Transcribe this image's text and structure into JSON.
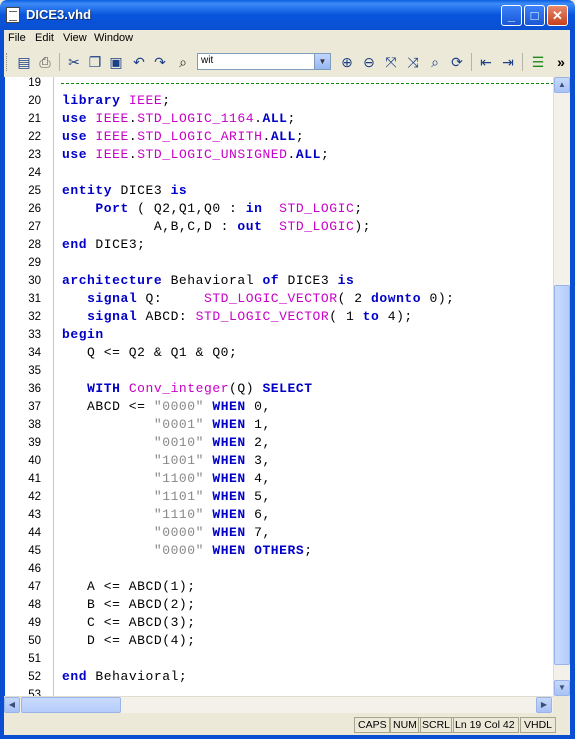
{
  "window": {
    "title": "DICE3.vhd",
    "minimize": "_",
    "maximize": "□",
    "close": "✕"
  },
  "menu": [
    "File",
    "Edit",
    "View",
    "Window"
  ],
  "toolbar": {
    "search_value": "wit",
    "icons": [
      "save-icon",
      "print-icon",
      "cut-icon",
      "copy-icon",
      "paste-icon",
      "undo-icon",
      "redo-icon",
      "find-icon",
      "zoom-in-icon",
      "zoom-out-icon",
      "fit-icon",
      "zoom-reset-icon",
      "zoom-custom-icon",
      "refresh-icon",
      "outdent-icon",
      "indent-icon",
      "comment-icon",
      "more-icon"
    ]
  },
  "editor": {
    "lines": [
      {
        "n": "19",
        "t": []
      },
      {
        "n": "20",
        "t": [
          {
            "c": "kw",
            "s": "library"
          },
          {
            "c": "",
            "s": " "
          },
          {
            "c": "ty",
            "s": "IEEE"
          },
          {
            "c": "",
            "s": ";"
          }
        ]
      },
      {
        "n": "21",
        "t": [
          {
            "c": "kw",
            "s": "use"
          },
          {
            "c": "",
            "s": " "
          },
          {
            "c": "ty",
            "s": "IEEE"
          },
          {
            "c": "",
            "s": "."
          },
          {
            "c": "ty",
            "s": "STD_LOGIC_1164"
          },
          {
            "c": "",
            "s": "."
          },
          {
            "c": "kw",
            "s": "ALL"
          },
          {
            "c": "",
            "s": ";"
          }
        ]
      },
      {
        "n": "22",
        "t": [
          {
            "c": "kw",
            "s": "use"
          },
          {
            "c": "",
            "s": " "
          },
          {
            "c": "ty",
            "s": "IEEE"
          },
          {
            "c": "",
            "s": "."
          },
          {
            "c": "ty",
            "s": "STD_LOGIC_ARITH"
          },
          {
            "c": "",
            "s": "."
          },
          {
            "c": "kw",
            "s": "ALL"
          },
          {
            "c": "",
            "s": ";"
          }
        ]
      },
      {
        "n": "23",
        "t": [
          {
            "c": "kw",
            "s": "use"
          },
          {
            "c": "",
            "s": " "
          },
          {
            "c": "ty",
            "s": "IEEE"
          },
          {
            "c": "",
            "s": "."
          },
          {
            "c": "ty",
            "s": "STD_LOGIC_UNSIGNED"
          },
          {
            "c": "",
            "s": "."
          },
          {
            "c": "kw",
            "s": "ALL"
          },
          {
            "c": "",
            "s": ";"
          }
        ]
      },
      {
        "n": "24",
        "t": []
      },
      {
        "n": "25",
        "t": [
          {
            "c": "kw",
            "s": "entity"
          },
          {
            "c": "",
            "s": " DICE3 "
          },
          {
            "c": "kw",
            "s": "is"
          }
        ]
      },
      {
        "n": "26",
        "t": [
          {
            "c": "",
            "s": "    "
          },
          {
            "c": "kw",
            "s": "Port"
          },
          {
            "c": "",
            "s": " ( Q2,Q1,Q0 : "
          },
          {
            "c": "kw",
            "s": "in"
          },
          {
            "c": "",
            "s": "  "
          },
          {
            "c": "ty",
            "s": "STD_LOGIC"
          },
          {
            "c": "",
            "s": ";"
          }
        ]
      },
      {
        "n": "27",
        "t": [
          {
            "c": "",
            "s": "           A,B,C,D : "
          },
          {
            "c": "kw",
            "s": "out"
          },
          {
            "c": "",
            "s": "  "
          },
          {
            "c": "ty",
            "s": "STD_LOGIC"
          },
          {
            "c": "",
            "s": ");"
          }
        ]
      },
      {
        "n": "28",
        "t": [
          {
            "c": "kw",
            "s": "end"
          },
          {
            "c": "",
            "s": " DICE3;"
          }
        ]
      },
      {
        "n": "29",
        "t": []
      },
      {
        "n": "30",
        "t": [
          {
            "c": "kw",
            "s": "architecture"
          },
          {
            "c": "",
            "s": " Behavioral "
          },
          {
            "c": "kw",
            "s": "of"
          },
          {
            "c": "",
            "s": " DICE3 "
          },
          {
            "c": "kw",
            "s": "is"
          }
        ]
      },
      {
        "n": "31",
        "t": [
          {
            "c": "",
            "s": "   "
          },
          {
            "c": "kw",
            "s": "signal"
          },
          {
            "c": "",
            "s": " Q:     "
          },
          {
            "c": "ty",
            "s": "STD_LOGIC_VECTOR"
          },
          {
            "c": "",
            "s": "( 2 "
          },
          {
            "c": "kw",
            "s": "downto"
          },
          {
            "c": "",
            "s": " 0);"
          }
        ]
      },
      {
        "n": "32",
        "t": [
          {
            "c": "",
            "s": "   "
          },
          {
            "c": "kw",
            "s": "signal"
          },
          {
            "c": "",
            "s": " ABCD: "
          },
          {
            "c": "ty",
            "s": "STD_LOGIC_VECTOR"
          },
          {
            "c": "",
            "s": "( 1 "
          },
          {
            "c": "kw",
            "s": "to"
          },
          {
            "c": "",
            "s": " 4);"
          }
        ]
      },
      {
        "n": "33",
        "t": [
          {
            "c": "kw",
            "s": "begin"
          }
        ]
      },
      {
        "n": "34",
        "t": [
          {
            "c": "",
            "s": "   Q <= Q2 & Q1 & Q0;"
          }
        ]
      },
      {
        "n": "35",
        "t": []
      },
      {
        "n": "36",
        "t": [
          {
            "c": "",
            "s": "   "
          },
          {
            "c": "kw",
            "s": "WITH"
          },
          {
            "c": "",
            "s": " "
          },
          {
            "c": "ty",
            "s": "Conv_integer"
          },
          {
            "c": "",
            "s": "(Q) "
          },
          {
            "c": "kw",
            "s": "SELECT"
          }
        ]
      },
      {
        "n": "37",
        "t": [
          {
            "c": "",
            "s": "   ABCD <= "
          },
          {
            "c": "st",
            "s": "\"0000\""
          },
          {
            "c": "",
            "s": " "
          },
          {
            "c": "kw",
            "s": "WHEN"
          },
          {
            "c": "",
            "s": " 0,"
          }
        ]
      },
      {
        "n": "38",
        "t": [
          {
            "c": "",
            "s": "           "
          },
          {
            "c": "st",
            "s": "\"0001\""
          },
          {
            "c": "",
            "s": " "
          },
          {
            "c": "kw",
            "s": "WHEN"
          },
          {
            "c": "",
            "s": " 1,"
          }
        ]
      },
      {
        "n": "39",
        "t": [
          {
            "c": "",
            "s": "           "
          },
          {
            "c": "st",
            "s": "\"0010\""
          },
          {
            "c": "",
            "s": " "
          },
          {
            "c": "kw",
            "s": "WHEN"
          },
          {
            "c": "",
            "s": " 2,"
          }
        ]
      },
      {
        "n": "40",
        "t": [
          {
            "c": "",
            "s": "           "
          },
          {
            "c": "st",
            "s": "\"1001\""
          },
          {
            "c": "",
            "s": " "
          },
          {
            "c": "kw",
            "s": "WHEN"
          },
          {
            "c": "",
            "s": " 3,"
          }
        ]
      },
      {
        "n": "41",
        "t": [
          {
            "c": "",
            "s": "           "
          },
          {
            "c": "st",
            "s": "\"1100\""
          },
          {
            "c": "",
            "s": " "
          },
          {
            "c": "kw",
            "s": "WHEN"
          },
          {
            "c": "",
            "s": " 4,"
          }
        ]
      },
      {
        "n": "42",
        "t": [
          {
            "c": "",
            "s": "           "
          },
          {
            "c": "st",
            "s": "\"1101\""
          },
          {
            "c": "",
            "s": " "
          },
          {
            "c": "kw",
            "s": "WHEN"
          },
          {
            "c": "",
            "s": " 5,"
          }
        ]
      },
      {
        "n": "43",
        "t": [
          {
            "c": "",
            "s": "           "
          },
          {
            "c": "st",
            "s": "\"1110\""
          },
          {
            "c": "",
            "s": " "
          },
          {
            "c": "kw",
            "s": "WHEN"
          },
          {
            "c": "",
            "s": " 6,"
          }
        ]
      },
      {
        "n": "44",
        "t": [
          {
            "c": "",
            "s": "           "
          },
          {
            "c": "st",
            "s": "\"0000\""
          },
          {
            "c": "",
            "s": " "
          },
          {
            "c": "kw",
            "s": "WHEN"
          },
          {
            "c": "",
            "s": " 7,"
          }
        ]
      },
      {
        "n": "45",
        "t": [
          {
            "c": "",
            "s": "           "
          },
          {
            "c": "st",
            "s": "\"0000\""
          },
          {
            "c": "",
            "s": " "
          },
          {
            "c": "kw",
            "s": "WHEN"
          },
          {
            "c": "",
            "s": " "
          },
          {
            "c": "kw",
            "s": "OTHERS"
          },
          {
            "c": "",
            "s": ";"
          }
        ]
      },
      {
        "n": "46",
        "t": []
      },
      {
        "n": "47",
        "t": [
          {
            "c": "",
            "s": "   A <= ABCD(1);"
          }
        ]
      },
      {
        "n": "48",
        "t": [
          {
            "c": "",
            "s": "   B <= ABCD(2);"
          }
        ]
      },
      {
        "n": "49",
        "t": [
          {
            "c": "",
            "s": "   C <= ABCD(3);"
          }
        ]
      },
      {
        "n": "50",
        "t": [
          {
            "c": "",
            "s": "   D <= ABCD(4);"
          }
        ]
      },
      {
        "n": "51",
        "t": []
      },
      {
        "n": "52",
        "t": [
          {
            "c": "kw",
            "s": "end"
          },
          {
            "c": "",
            "s": " Behavioral;"
          }
        ]
      },
      {
        "n": "53",
        "t": []
      }
    ]
  },
  "status": {
    "caps": "CAPS",
    "num": "NUM",
    "scrl": "SCRL",
    "position": "Ln 19 Col 42",
    "language": "VHDL"
  },
  "colors": {
    "keyword": "#0000c8",
    "type": "#c800c8",
    "string": "#888888",
    "titlebar": "#0a55dd"
  }
}
